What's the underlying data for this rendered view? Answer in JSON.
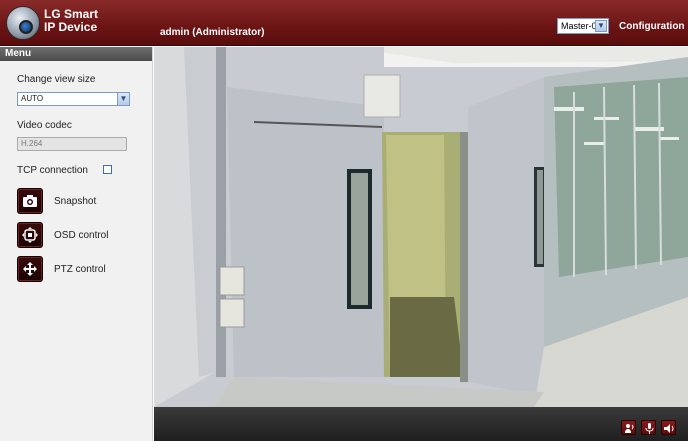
{
  "header": {
    "brand_line1": "LG Smart",
    "brand_line2": "IP Device",
    "user": "admin (Administrator)",
    "master_select": "Master-0",
    "configuration": "Configuration"
  },
  "sidebar": {
    "menu_title": "Menu",
    "change_view_size_label": "Change view size",
    "view_size_value": "AUTO",
    "video_codec_label": "Video codec",
    "video_codec_value": "H.264",
    "tcp_label": "TCP connection",
    "tcp_checked": false,
    "actions": [
      {
        "label": "Snapshot",
        "icon": "camera-icon"
      },
      {
        "label": "OSD control",
        "icon": "osd-icon"
      },
      {
        "label": "PTZ control",
        "icon": "ptz-icon"
      }
    ]
  },
  "video_controls": [
    {
      "icon": "speaker-talk-icon"
    },
    {
      "icon": "microphone-icon"
    },
    {
      "icon": "volume-icon"
    }
  ],
  "colors": {
    "header": "#6b1414",
    "sidebar": "#f1f1f1",
    "control_bar": "#2a2a2a"
  }
}
